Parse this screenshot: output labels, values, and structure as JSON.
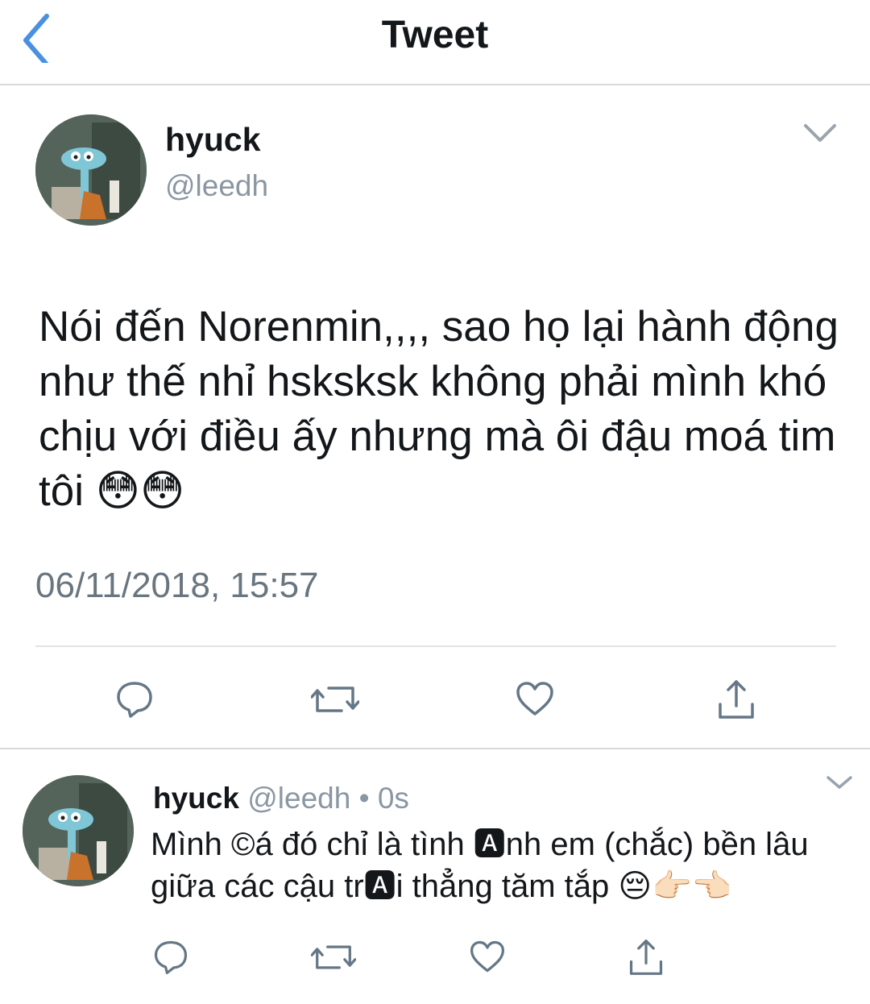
{
  "header": {
    "title": "Tweet"
  },
  "main_tweet": {
    "author": {
      "name": "hyuck",
      "handle": "@leedh"
    },
    "text": "Nói đến Norenmin,,,, sao họ lại hành động như thế nhỉ hsksksk không phải mình khó chịu với điều ấy nhưng mà ôi đậu moá tim tôi 😳😳",
    "timestamp": "06/11/2018, 15:57",
    "actions": [
      "reply-icon",
      "retweet-icon",
      "like-icon",
      "share-icon"
    ]
  },
  "reply_tweet": {
    "author": {
      "name": "hyuck",
      "handle": "@leedh"
    },
    "separator": "•",
    "time": "0s",
    "text": "Mình ©á đó chỉ là tình 🅰nh em (chắc) bền lâu giữa các cậu tr🅰i thẳng tăm tắp 😔👉🏻👈🏻",
    "actions": [
      "reply-icon",
      "retweet-icon",
      "like-icon",
      "share-icon"
    ]
  },
  "colors": {
    "accent": "#1da1f2",
    "icon": "#657786",
    "secondary_text": "#8a97a3"
  }
}
